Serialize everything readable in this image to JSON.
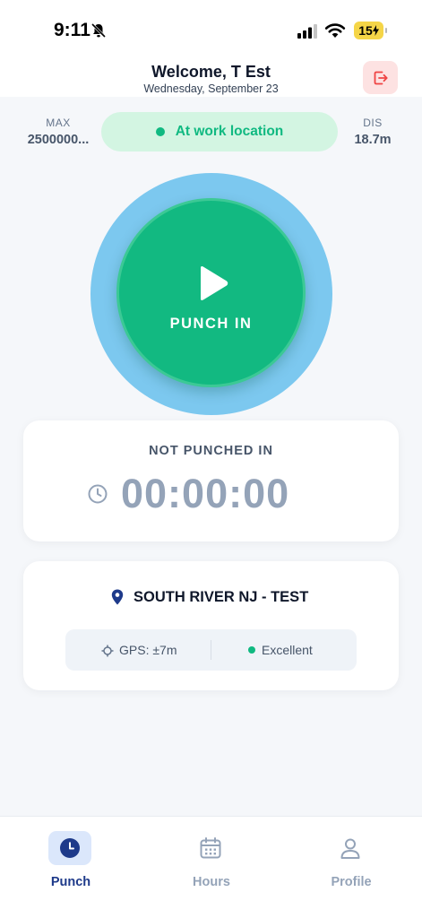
{
  "status_bar": {
    "time": "9:11",
    "battery": "15"
  },
  "header": {
    "welcome": "Welcome, T Est",
    "date": "Wednesday, September 23"
  },
  "stats": {
    "max_label": "MAX",
    "max_value": "2500000...",
    "dis_label": "DIS",
    "dis_value": "18.7m"
  },
  "location_status": "At work location",
  "punch": {
    "label": "PUNCH IN"
  },
  "status_card": {
    "status": "NOT PUNCHED IN",
    "timer": "00:00:00"
  },
  "site_card": {
    "name": "SOUTH RIVER NJ - TEST",
    "gps": "GPS: ±7m",
    "quality": "Excellent"
  },
  "nav": {
    "items": [
      {
        "label": "Punch",
        "icon": "clock-icon",
        "active": true
      },
      {
        "label": "Hours",
        "icon": "calendar-icon",
        "active": false
      },
      {
        "label": "Profile",
        "icon": "person-icon",
        "active": false
      }
    ]
  },
  "colors": {
    "primary_green": "#12b981",
    "halo_blue": "#7cc8ef",
    "nav_active": "#1e3a8a",
    "logout_bg": "#fde2e2",
    "logout_icon": "#ef4444"
  }
}
